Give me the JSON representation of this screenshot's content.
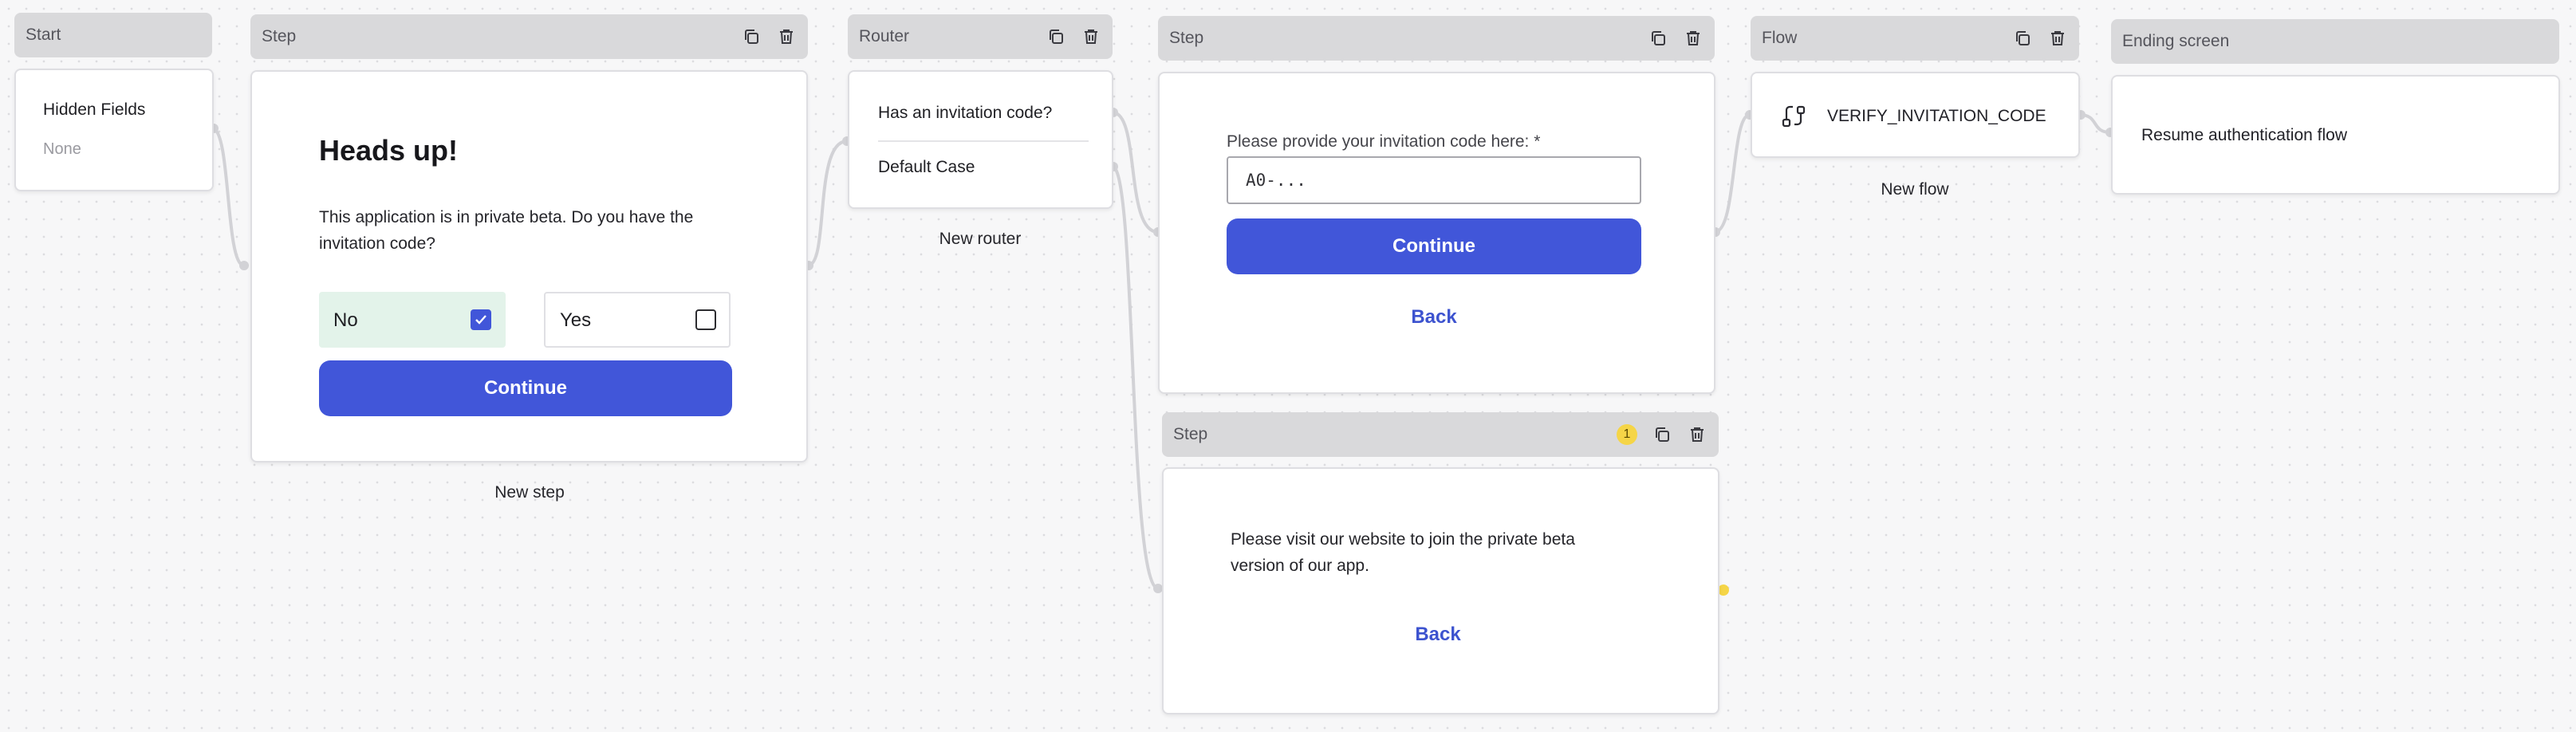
{
  "start": {
    "header": "Start",
    "field_label": "Hidden Fields",
    "field_value": "None"
  },
  "step1": {
    "header": "Step",
    "title": "Heads up!",
    "body": "This application is in private beta. Do you have the invitation code?",
    "options": [
      {
        "label": "No",
        "checked": true
      },
      {
        "label": "Yes",
        "checked": false
      }
    ],
    "continue_label": "Continue",
    "caption": "New step"
  },
  "router": {
    "header": "Router",
    "conditions": [
      "Has an invitation code?",
      "Default Case"
    ],
    "caption": "New router"
  },
  "step2": {
    "header": "Step",
    "input_label": "Please provide your invitation code here: *",
    "input_placeholder": "A0-...",
    "continue_label": "Continue",
    "back_label": "Back"
  },
  "step3": {
    "header": "Step",
    "badge": "1",
    "body": "Please visit our website to join the private beta version of our app.",
    "back_label": "Back"
  },
  "flow": {
    "header": "Flow",
    "name": "VERIFY_INVITATION_CODE",
    "caption": "New flow"
  },
  "ending": {
    "header": "Ending screen",
    "body": "Resume authentication flow"
  },
  "colors": {
    "accent": "#4156d9",
    "selected_bg": "#e3f3ea",
    "warning": "#f5d547",
    "connector": "#d2d2d6"
  }
}
